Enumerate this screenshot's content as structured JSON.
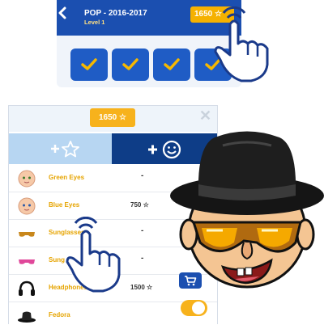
{
  "level_header": {
    "title": "POP - 2016-2017",
    "subtitle": "Level 1",
    "score": "1650"
  },
  "level_tiles": [
    {
      "state": "completed",
      "icon": "checkmark-icon"
    },
    {
      "state": "completed",
      "icon": "checkmark-icon"
    },
    {
      "state": "completed",
      "icon": "checkmark-icon"
    },
    {
      "state": "completed",
      "icon": "checkmark-icon"
    }
  ],
  "shop": {
    "score": "1650",
    "tabs": [
      {
        "name": "stars",
        "icon": "plus-star-icon",
        "active": false
      },
      {
        "name": "emoji",
        "icon": "plus-smiley-icon",
        "active": true
      }
    ],
    "items": [
      {
        "name": "Green Eyes",
        "price": "",
        "icon": "baby-face-icon",
        "action": "none"
      },
      {
        "name": "Blue Eyes",
        "price": "750",
        "icon": "baby-face-icon",
        "action": "none"
      },
      {
        "name": "Sunglasses",
        "price": "",
        "icon": "sunglasses-icon",
        "action": "none"
      },
      {
        "name": "Sung",
        "price": "",
        "icon": "pink-sunglasses-icon",
        "action": "none"
      },
      {
        "name": "Headphones",
        "price": "1500",
        "icon": "headphones-icon",
        "action": "cart"
      },
      {
        "name": "Fedora",
        "price": "",
        "icon": "fedora-icon",
        "action": "toggle-on"
      }
    ]
  },
  "colors": {
    "header_blue": "#1b4fb0",
    "tab_dark": "#0e3d87",
    "tab_light": "#b7d6f2",
    "gold": "#f7b21c",
    "item_label": "#e6a400"
  }
}
